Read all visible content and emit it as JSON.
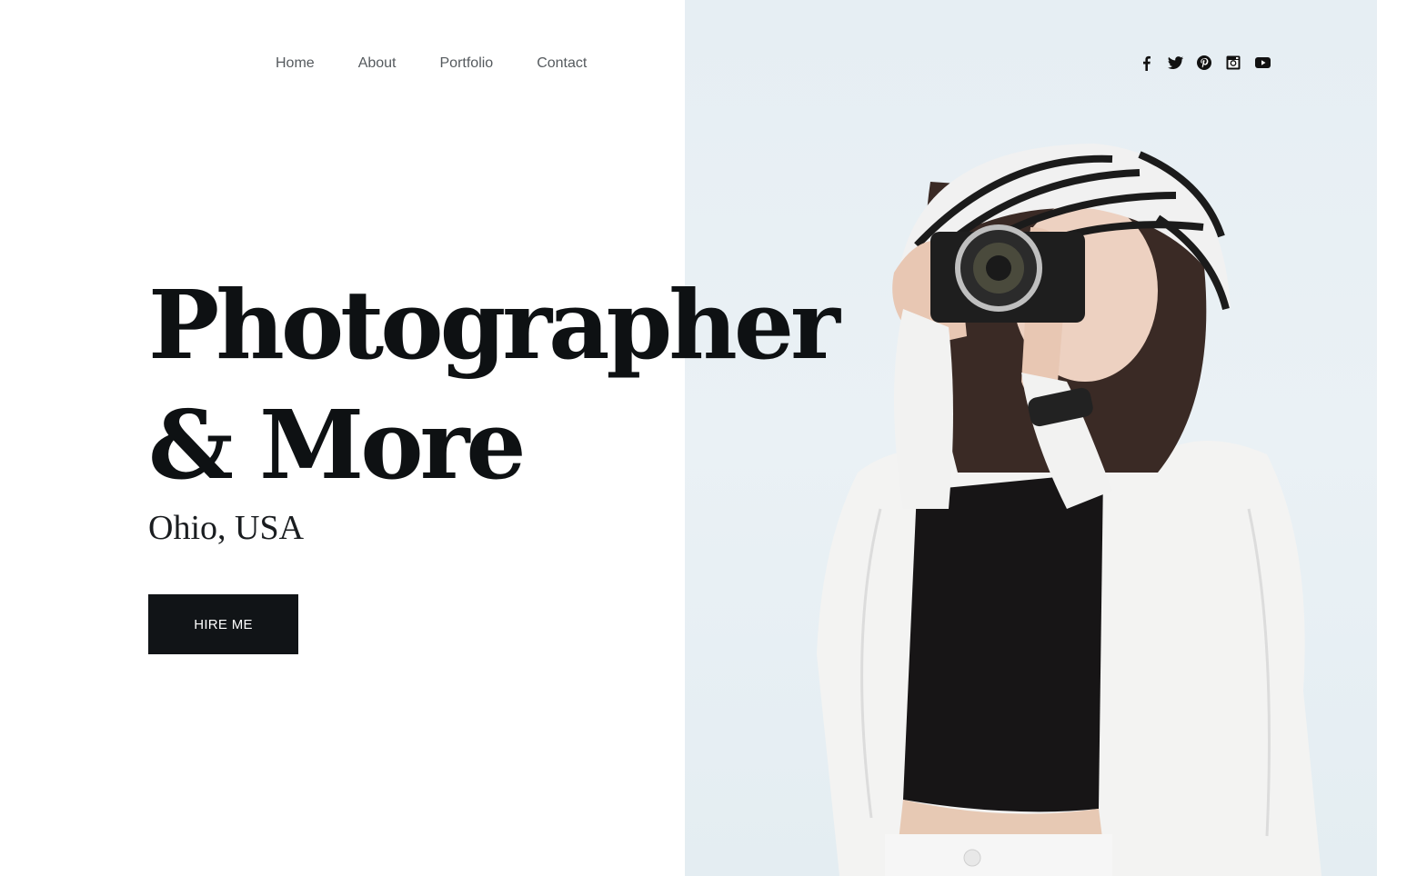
{
  "nav": {
    "items": [
      {
        "label": "Home"
      },
      {
        "label": "About"
      },
      {
        "label": "Portfolio"
      },
      {
        "label": "Contact"
      }
    ]
  },
  "social": {
    "icons": [
      "facebook-icon",
      "twitter-icon",
      "pinterest-icon",
      "instagram-icon",
      "youtube-icon"
    ]
  },
  "hero": {
    "headline_line1": "Photographer",
    "headline_line2": "& More",
    "location": "Ohio, USA",
    "cta_label": "HIRE ME"
  },
  "colors": {
    "text_dark": "#0e1113",
    "nav_text": "#555a5e",
    "button_bg": "#111417",
    "photo_bg": "#e6eef3"
  }
}
